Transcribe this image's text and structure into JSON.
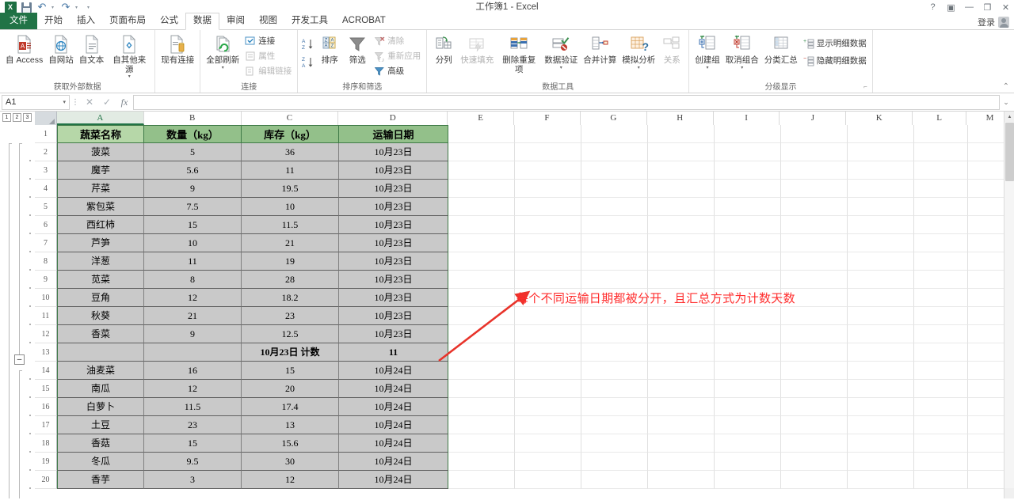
{
  "window": {
    "title": "工作簿1 - Excel",
    "quick_access": [
      "save-icon",
      "undo-icon",
      "redo-icon",
      "customize-icon"
    ],
    "help_label": "?",
    "ribbon_display_label": "▣",
    "minimize_label": "—",
    "restore_label": "❐",
    "close_label": "✕",
    "signin_label": "登录"
  },
  "tabs": [
    {
      "label": "文件",
      "active": false,
      "file": true
    },
    {
      "label": "开始",
      "active": false
    },
    {
      "label": "插入",
      "active": false
    },
    {
      "label": "页面布局",
      "active": false
    },
    {
      "label": "公式",
      "active": false
    },
    {
      "label": "数据",
      "active": true
    },
    {
      "label": "审阅",
      "active": false
    },
    {
      "label": "视图",
      "active": false
    },
    {
      "label": "开发工具",
      "active": false
    },
    {
      "label": "ACROBAT",
      "active": false
    }
  ],
  "ribbon": {
    "collapse_label": "⌃",
    "groups": [
      {
        "title": "获取外部数据",
        "big_buttons": [
          {
            "label": "自 Access",
            "icon": "access-db-icon",
            "disabled": false
          },
          {
            "label": "自网站",
            "icon": "web-globe-icon",
            "disabled": false
          },
          {
            "label": "自文本",
            "icon": "text-file-icon",
            "disabled": false
          },
          {
            "label": "自其他来源",
            "icon": "other-sources-icon",
            "disabled": false,
            "caret": true
          },
          {
            "label": "现有连接",
            "icon": "existing-connection-icon",
            "disabled": false
          }
        ]
      },
      {
        "title": "连接",
        "big_buttons": [
          {
            "label": "全部刷新",
            "icon": "refresh-all-icon",
            "disabled": false,
            "caret": true
          }
        ],
        "small_buttons": [
          {
            "label": "连接",
            "icon": "connections-icon",
            "disabled": false
          },
          {
            "label": "属性",
            "icon": "properties-icon",
            "disabled": true
          },
          {
            "label": "编辑链接",
            "icon": "edit-links-icon",
            "disabled": true
          }
        ]
      },
      {
        "title": "排序和筛选",
        "big_buttons": [
          {
            "label": "排序",
            "icon": "sort-az-icon",
            "disabled": false
          },
          {
            "label": "筛选",
            "icon": "filter-funnel-icon",
            "disabled": false
          }
        ],
        "small_buttons": [
          {
            "label": "清除",
            "icon": "clear-filter-icon",
            "disabled": true
          },
          {
            "label": "重新应用",
            "icon": "reapply-icon",
            "disabled": true
          },
          {
            "label": "高级",
            "icon": "advanced-filter-icon",
            "disabled": false
          }
        ],
        "sort_small": [
          {
            "label": "",
            "icon": "sort-ascending-icon"
          },
          {
            "label": "",
            "icon": "sort-descending-icon"
          }
        ]
      },
      {
        "title": "数据工具",
        "big_buttons": [
          {
            "label": "分列",
            "icon": "text-to-columns-icon",
            "disabled": false
          },
          {
            "label": "快速填充",
            "icon": "flash-fill-icon",
            "disabled": true
          },
          {
            "label": "删除重复项",
            "icon": "remove-duplicates-icon",
            "disabled": false
          },
          {
            "label": "数据验证",
            "icon": "data-validation-icon",
            "disabled": false,
            "caret": true
          },
          {
            "label": "合并计算",
            "icon": "consolidate-icon",
            "disabled": false
          },
          {
            "label": "模拟分析",
            "icon": "what-if-analysis-icon",
            "disabled": false,
            "caret": true
          },
          {
            "label": "关系",
            "icon": "relationships-icon",
            "disabled": true
          }
        ]
      },
      {
        "title": "分级显示",
        "dialog_launcher": "⌐",
        "big_buttons": [
          {
            "label": "创建组",
            "icon": "group-icon",
            "disabled": false,
            "caret": true
          },
          {
            "label": "取消组合",
            "icon": "ungroup-icon",
            "disabled": false,
            "caret": true
          },
          {
            "label": "分类汇总",
            "icon": "subtotal-icon",
            "disabled": false
          }
        ],
        "small_buttons": [
          {
            "label": "显示明细数据",
            "icon": "show-detail-icon",
            "disabled": false
          },
          {
            "label": "隐藏明细数据",
            "icon": "hide-detail-icon",
            "disabled": false
          }
        ]
      }
    ]
  },
  "formula_bar": {
    "name_box": "A1",
    "cancel_label": "✕",
    "enter_label": "✓",
    "fx_label": "fx",
    "value": "",
    "expand_label": "⌄"
  },
  "outline_pane": {
    "levels": [
      "1",
      "2",
      "3"
    ],
    "collapse_button_label": "–"
  },
  "sheet": {
    "column_headers": [
      "A",
      "B",
      "C",
      "D",
      "E",
      "F",
      "G",
      "H",
      "I",
      "J",
      "K",
      "L",
      "M"
    ],
    "row_numbers": [
      "1",
      "2",
      "3",
      "4",
      "5",
      "6",
      "7",
      "8",
      "9",
      "10",
      "11",
      "12",
      "13",
      "14",
      "15",
      "16",
      "17",
      "18",
      "19",
      "20"
    ],
    "table_headers": [
      "蔬菜名称",
      "数量（kg）",
      "库存（kg）",
      "运输日期"
    ],
    "rows": [
      {
        "row": "2",
        "type": "data",
        "cells": [
          "菠菜",
          "5",
          "36",
          "10月23日"
        ]
      },
      {
        "row": "3",
        "type": "data",
        "cells": [
          "魔芋",
          "5.6",
          "11",
          "10月23日"
        ]
      },
      {
        "row": "4",
        "type": "data",
        "cells": [
          "芹菜",
          "9",
          "19.5",
          "10月23日"
        ]
      },
      {
        "row": "5",
        "type": "data",
        "cells": [
          "紫包菜",
          "7.5",
          "10",
          "10月23日"
        ]
      },
      {
        "row": "6",
        "type": "data",
        "cells": [
          "西红柿",
          "15",
          "11.5",
          "10月23日"
        ]
      },
      {
        "row": "7",
        "type": "data",
        "cells": [
          "芦笋",
          "10",
          "21",
          "10月23日"
        ]
      },
      {
        "row": "8",
        "type": "data",
        "cells": [
          "洋葱",
          "11",
          "19",
          "10月23日"
        ]
      },
      {
        "row": "9",
        "type": "data",
        "cells": [
          "苋菜",
          "8",
          "28",
          "10月23日"
        ]
      },
      {
        "row": "10",
        "type": "data",
        "cells": [
          "豆角",
          "12",
          "18.2",
          "10月23日"
        ]
      },
      {
        "row": "11",
        "type": "data",
        "cells": [
          "秋葵",
          "21",
          "23",
          "10月23日"
        ]
      },
      {
        "row": "12",
        "type": "data",
        "cells": [
          "香菜",
          "9",
          "12.5",
          "10月23日"
        ]
      },
      {
        "row": "13",
        "type": "subtotal",
        "cells": [
          "",
          "",
          "10月23日  计数",
          "11"
        ]
      },
      {
        "row": "14",
        "type": "data",
        "cells": [
          "油麦菜",
          "16",
          "15",
          "10月24日"
        ]
      },
      {
        "row": "15",
        "type": "data",
        "cells": [
          "南瓜",
          "12",
          "20",
          "10月24日"
        ]
      },
      {
        "row": "16",
        "type": "data",
        "cells": [
          "白萝卜",
          "11.5",
          "17.4",
          "10月24日"
        ]
      },
      {
        "row": "17",
        "type": "data",
        "cells": [
          "土豆",
          "23",
          "13",
          "10月24日"
        ]
      },
      {
        "row": "18",
        "type": "data",
        "cells": [
          "香菇",
          "15",
          "15.6",
          "10月24日"
        ]
      },
      {
        "row": "19",
        "type": "data",
        "cells": [
          "冬瓜",
          "9.5",
          "30",
          "10月24日"
        ]
      },
      {
        "row": "20",
        "type": "data",
        "cells": [
          "香芋",
          "3",
          "12",
          "10月24日"
        ]
      }
    ]
  },
  "annotation": {
    "text": "每个不同运输日期都被分开，且汇总方式为计数天数",
    "color": "#ff2d2d",
    "arrow_color": "#e8332a"
  },
  "colors": {
    "excel_green": "#217346",
    "header_light_green": "#b6d7a8",
    "header_green": "#93c08a",
    "data_gray": "#c9c9c9"
  }
}
